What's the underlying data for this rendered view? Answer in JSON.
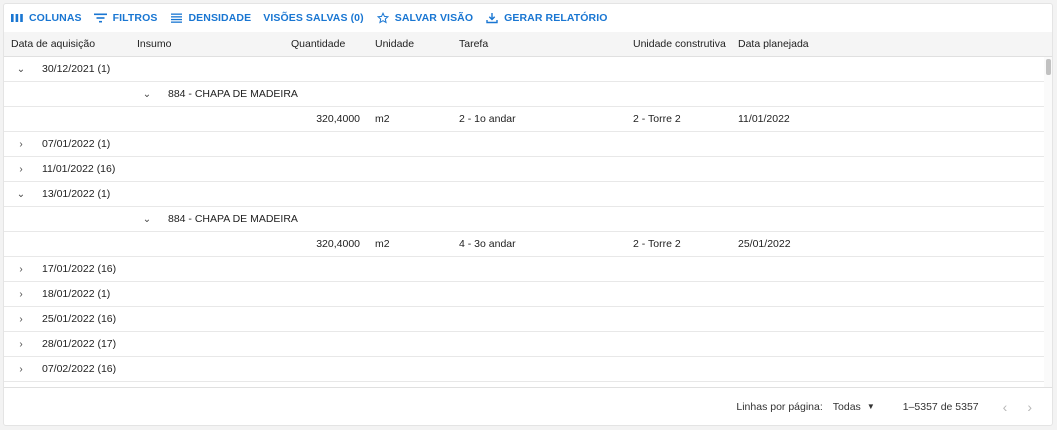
{
  "toolbar": {
    "columns": "COLUNAS",
    "filters": "FILTROS",
    "density": "DENSIDADE",
    "saved_views": "VISÕES SALVAS (0)",
    "save_view": "SALVAR VISÃO",
    "generate_report": "GERAR RELATÓRIO"
  },
  "columns": {
    "date": "Data de aquisição",
    "input": "Insumo",
    "quantity": "Quantidade",
    "unit": "Unidade",
    "task": "Tarefa",
    "construction_unit": "Unidade construtiva",
    "planned_date": "Data planejada"
  },
  "rows": [
    {
      "type": "group",
      "label": "30/12/2021 (1)",
      "expanded": true
    },
    {
      "type": "subgroup",
      "label": "884 - CHAPA DE MADEIRA",
      "expanded": true
    },
    {
      "type": "data",
      "quantity": "320,4000",
      "unit": "m2",
      "task": "2 - 1o andar",
      "construction_unit": "2 - Torre 2",
      "planned_date": "11/01/2022"
    },
    {
      "type": "group",
      "label": "07/01/2022 (1)",
      "expanded": false
    },
    {
      "type": "group",
      "label": "11/01/2022 (16)",
      "expanded": false
    },
    {
      "type": "group",
      "label": "13/01/2022 (1)",
      "expanded": true
    },
    {
      "type": "subgroup",
      "label": "884 - CHAPA DE MADEIRA",
      "expanded": true
    },
    {
      "type": "data",
      "quantity": "320,4000",
      "unit": "m2",
      "task": "4 - 3o andar",
      "construction_unit": "2 - Torre 2",
      "planned_date": "25/01/2022"
    },
    {
      "type": "group",
      "label": "17/01/2022 (16)",
      "expanded": false
    },
    {
      "type": "group",
      "label": "18/01/2022 (1)",
      "expanded": false
    },
    {
      "type": "group",
      "label": "25/01/2022 (16)",
      "expanded": false
    },
    {
      "type": "group",
      "label": "28/01/2022 (17)",
      "expanded": false
    },
    {
      "type": "group",
      "label": "07/02/2022 (16)",
      "expanded": false
    }
  ],
  "footer": {
    "rows_per_page_label": "Linhas por página:",
    "rows_per_page_value": "Todas",
    "range": "1–5357 de 5357"
  },
  "colors": {
    "accent": "#1976d2"
  }
}
